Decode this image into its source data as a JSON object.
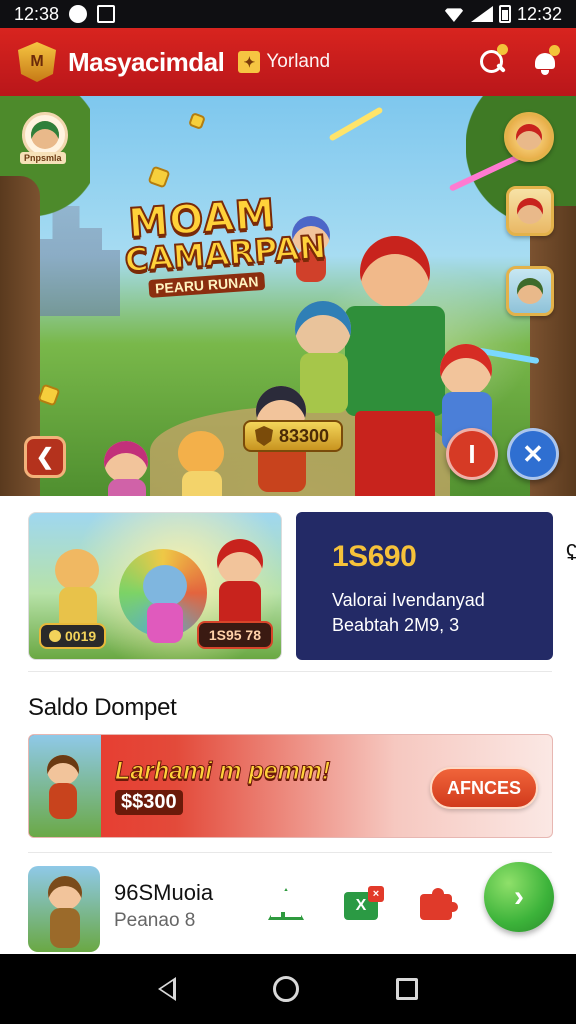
{
  "status_bar": {
    "time": "12:38",
    "battery_time": "12:32"
  },
  "app_bar": {
    "title": "Masyacimdal",
    "region_label": "Yorland",
    "logo_mark": "M"
  },
  "hero": {
    "title_line1": "MOAM",
    "title_line2": "CAMARPAN",
    "title_line3": "PEARU RUNAN",
    "score": "83300",
    "back_glyph": "❮",
    "action_red_glyph": "I",
    "action_blue_glyph": "✕",
    "avatar_tag": "Pnpsmla"
  },
  "promo": {
    "card_left_badge": "0019",
    "card_right_badge": "1S95 78",
    "info_amount": "1S690",
    "info_line1": "Valorai Ivendanyad",
    "info_line2": "Beabtah 2M9, 3",
    "edge_glyph": "ʢ"
  },
  "wallet": {
    "section_title": "Saldo Dompet",
    "banner_title": "Larhami m pemm!",
    "banner_amount": "$$300",
    "button_label": "AFNCES"
  },
  "game_item": {
    "name": "96SMuoia",
    "meta": "Peanao 8",
    "sheet_glyph": "X",
    "sheet_badge": "×",
    "go_glyph": "›"
  },
  "colors": {
    "brand_red": "#d8241f",
    "info_card_bg": "#232a66",
    "accent_gold": "#f6c23a",
    "go_green": "#3cb33a"
  },
  "icons": [
    "search-icon",
    "bell-icon",
    "tree-icon",
    "sheet-icon",
    "puzzle-icon",
    "nav-back-icon",
    "nav-home-icon",
    "nav-recent-icon"
  ]
}
